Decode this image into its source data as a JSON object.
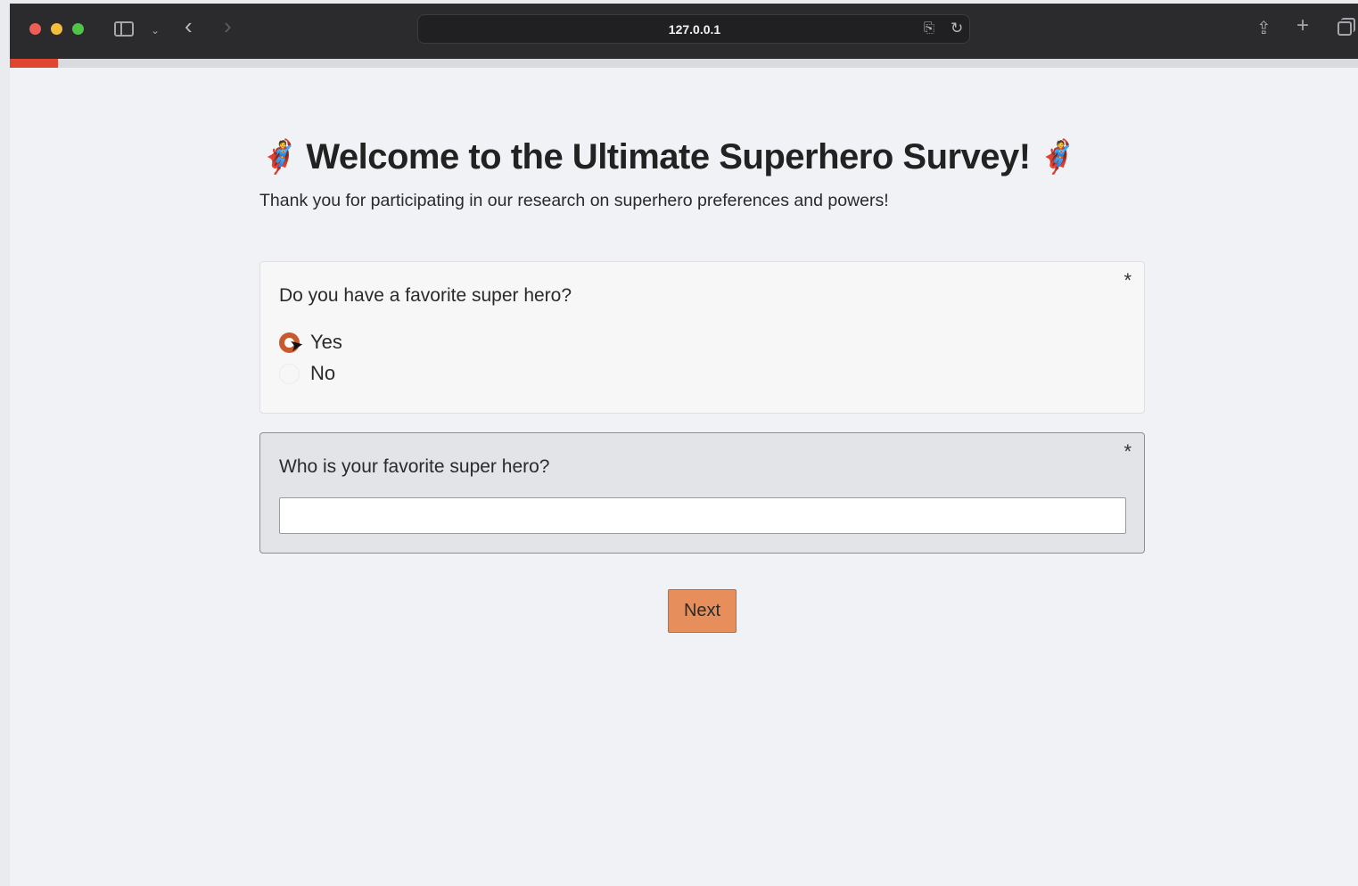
{
  "browser": {
    "url": "127.0.0.1",
    "icons": {
      "sidebar": "sidebar-icon",
      "back": "‹",
      "forward": "›",
      "chevron": "⌄",
      "translate": "⎘",
      "reload": "↻",
      "share": "⇪",
      "new_tab": "+",
      "tabs": "tabs-icon"
    }
  },
  "progress": {
    "fraction": 0.036,
    "color": "#e0452f"
  },
  "page": {
    "title_emoji": "🦸",
    "title": "Welcome to the Ultimate Superhero Survey!",
    "subtitle": "Thank you for participating in our research on superhero preferences and powers!"
  },
  "questions": [
    {
      "title": "Do you have a favorite super hero?",
      "required_mark": "*",
      "options": [
        {
          "label": "Yes",
          "selected": true
        },
        {
          "label": "No",
          "selected": false
        }
      ]
    },
    {
      "title": "Who is your favorite super hero?",
      "required_mark": "*",
      "value": "",
      "placeholder": ""
    }
  ],
  "buttons": {
    "next_label": "Next"
  },
  "colors": {
    "accent": "#c85a2d",
    "button": "#e68e5c"
  }
}
